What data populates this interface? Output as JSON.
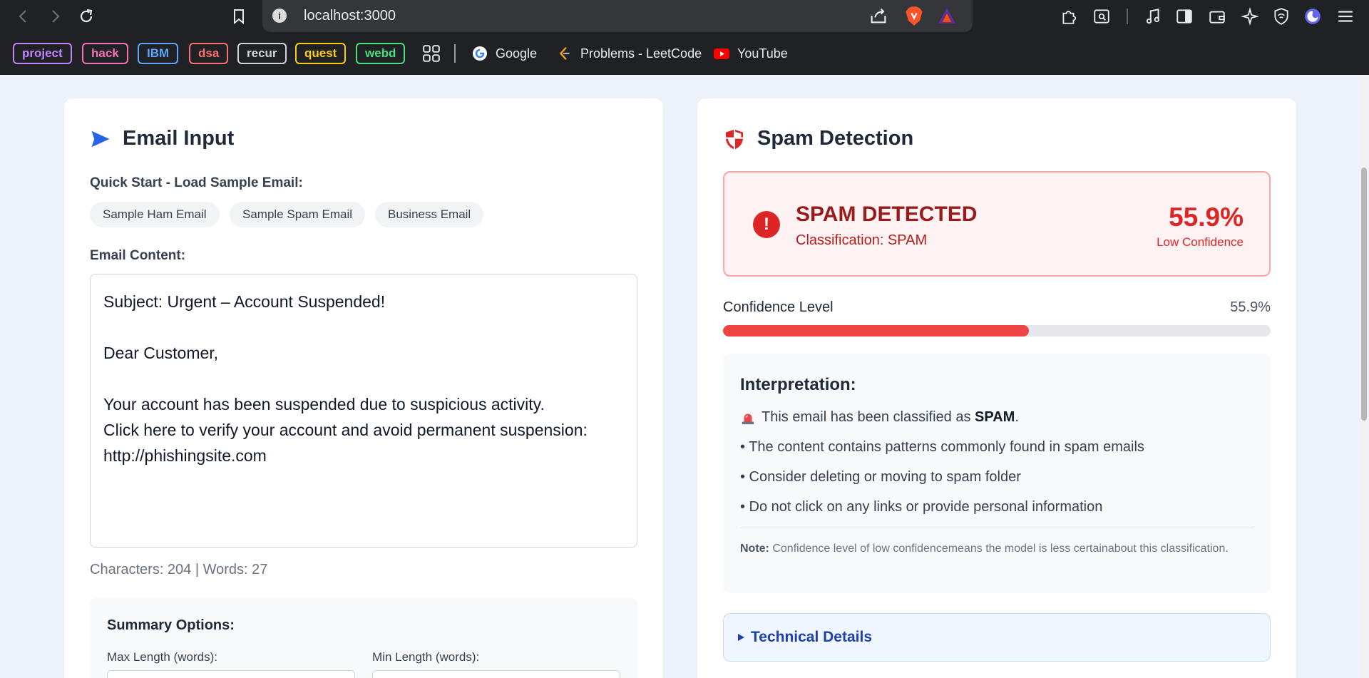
{
  "browser": {
    "url": "localhost:3000",
    "bookmark_chips": [
      {
        "label": "project",
        "color": "#c084fc"
      },
      {
        "label": "hack",
        "color": "#f472b6"
      },
      {
        "label": "IBM",
        "color": "#60a5fa"
      },
      {
        "label": "dsa",
        "color": "#f87171"
      },
      {
        "label": "recur",
        "color": "#d1d5db"
      },
      {
        "label": "quest",
        "color": "#facc15"
      },
      {
        "label": "webd",
        "color": "#4ade80"
      }
    ],
    "bookmark_links": [
      {
        "label": "Google",
        "icon": "google-icon"
      },
      {
        "label": "Problems - LeetCode",
        "icon": "leetcode-icon"
      },
      {
        "label": "YouTube",
        "icon": "youtube-icon"
      }
    ]
  },
  "email_input": {
    "title": "Email Input",
    "quick_start_label": "Quick Start - Load Sample Email:",
    "sample_buttons": [
      "Sample Ham Email",
      "Sample Spam Email",
      "Business Email"
    ],
    "content_label": "Email Content:",
    "content": "Subject: Urgent – Account Suspended!\n\nDear Customer,\n\nYour account has been suspended due to suspicious activity.\nClick here to verify your account and avoid permanent suspension:\nhttp://phishingsite.com",
    "counts": "Characters: 204 | Words: 27",
    "summary_title": "Summary Options:",
    "max_length_label": "Max Length (words):",
    "min_length_label": "Min Length (words):"
  },
  "spam_detection": {
    "title": "Spam Detection",
    "result_title": "SPAM DETECTED",
    "result_classification": "Classification: SPAM",
    "result_percent": "55.9%",
    "result_confidence": "Low Confidence",
    "confidence_label": "Confidence Level",
    "confidence_value": "55.9%",
    "confidence_fraction": 0.559,
    "interpretation_title": "Interpretation:",
    "interpretation_lead": "This email has been classified as",
    "interpretation_class": "SPAM",
    "interpretation_end": ".",
    "bullets": [
      "• The content contains patterns commonly found in spam emails",
      "• Consider deleting or moving to spam folder",
      "• Do not click on any links or provide personal information"
    ],
    "note_label": "Note:",
    "note_text": "Confidence level of low confidencemeans the model is less certainabout this classification.",
    "technical_details": "Technical Details",
    "accent_red": "#dc2626",
    "accent_blue": "#1e40af"
  }
}
